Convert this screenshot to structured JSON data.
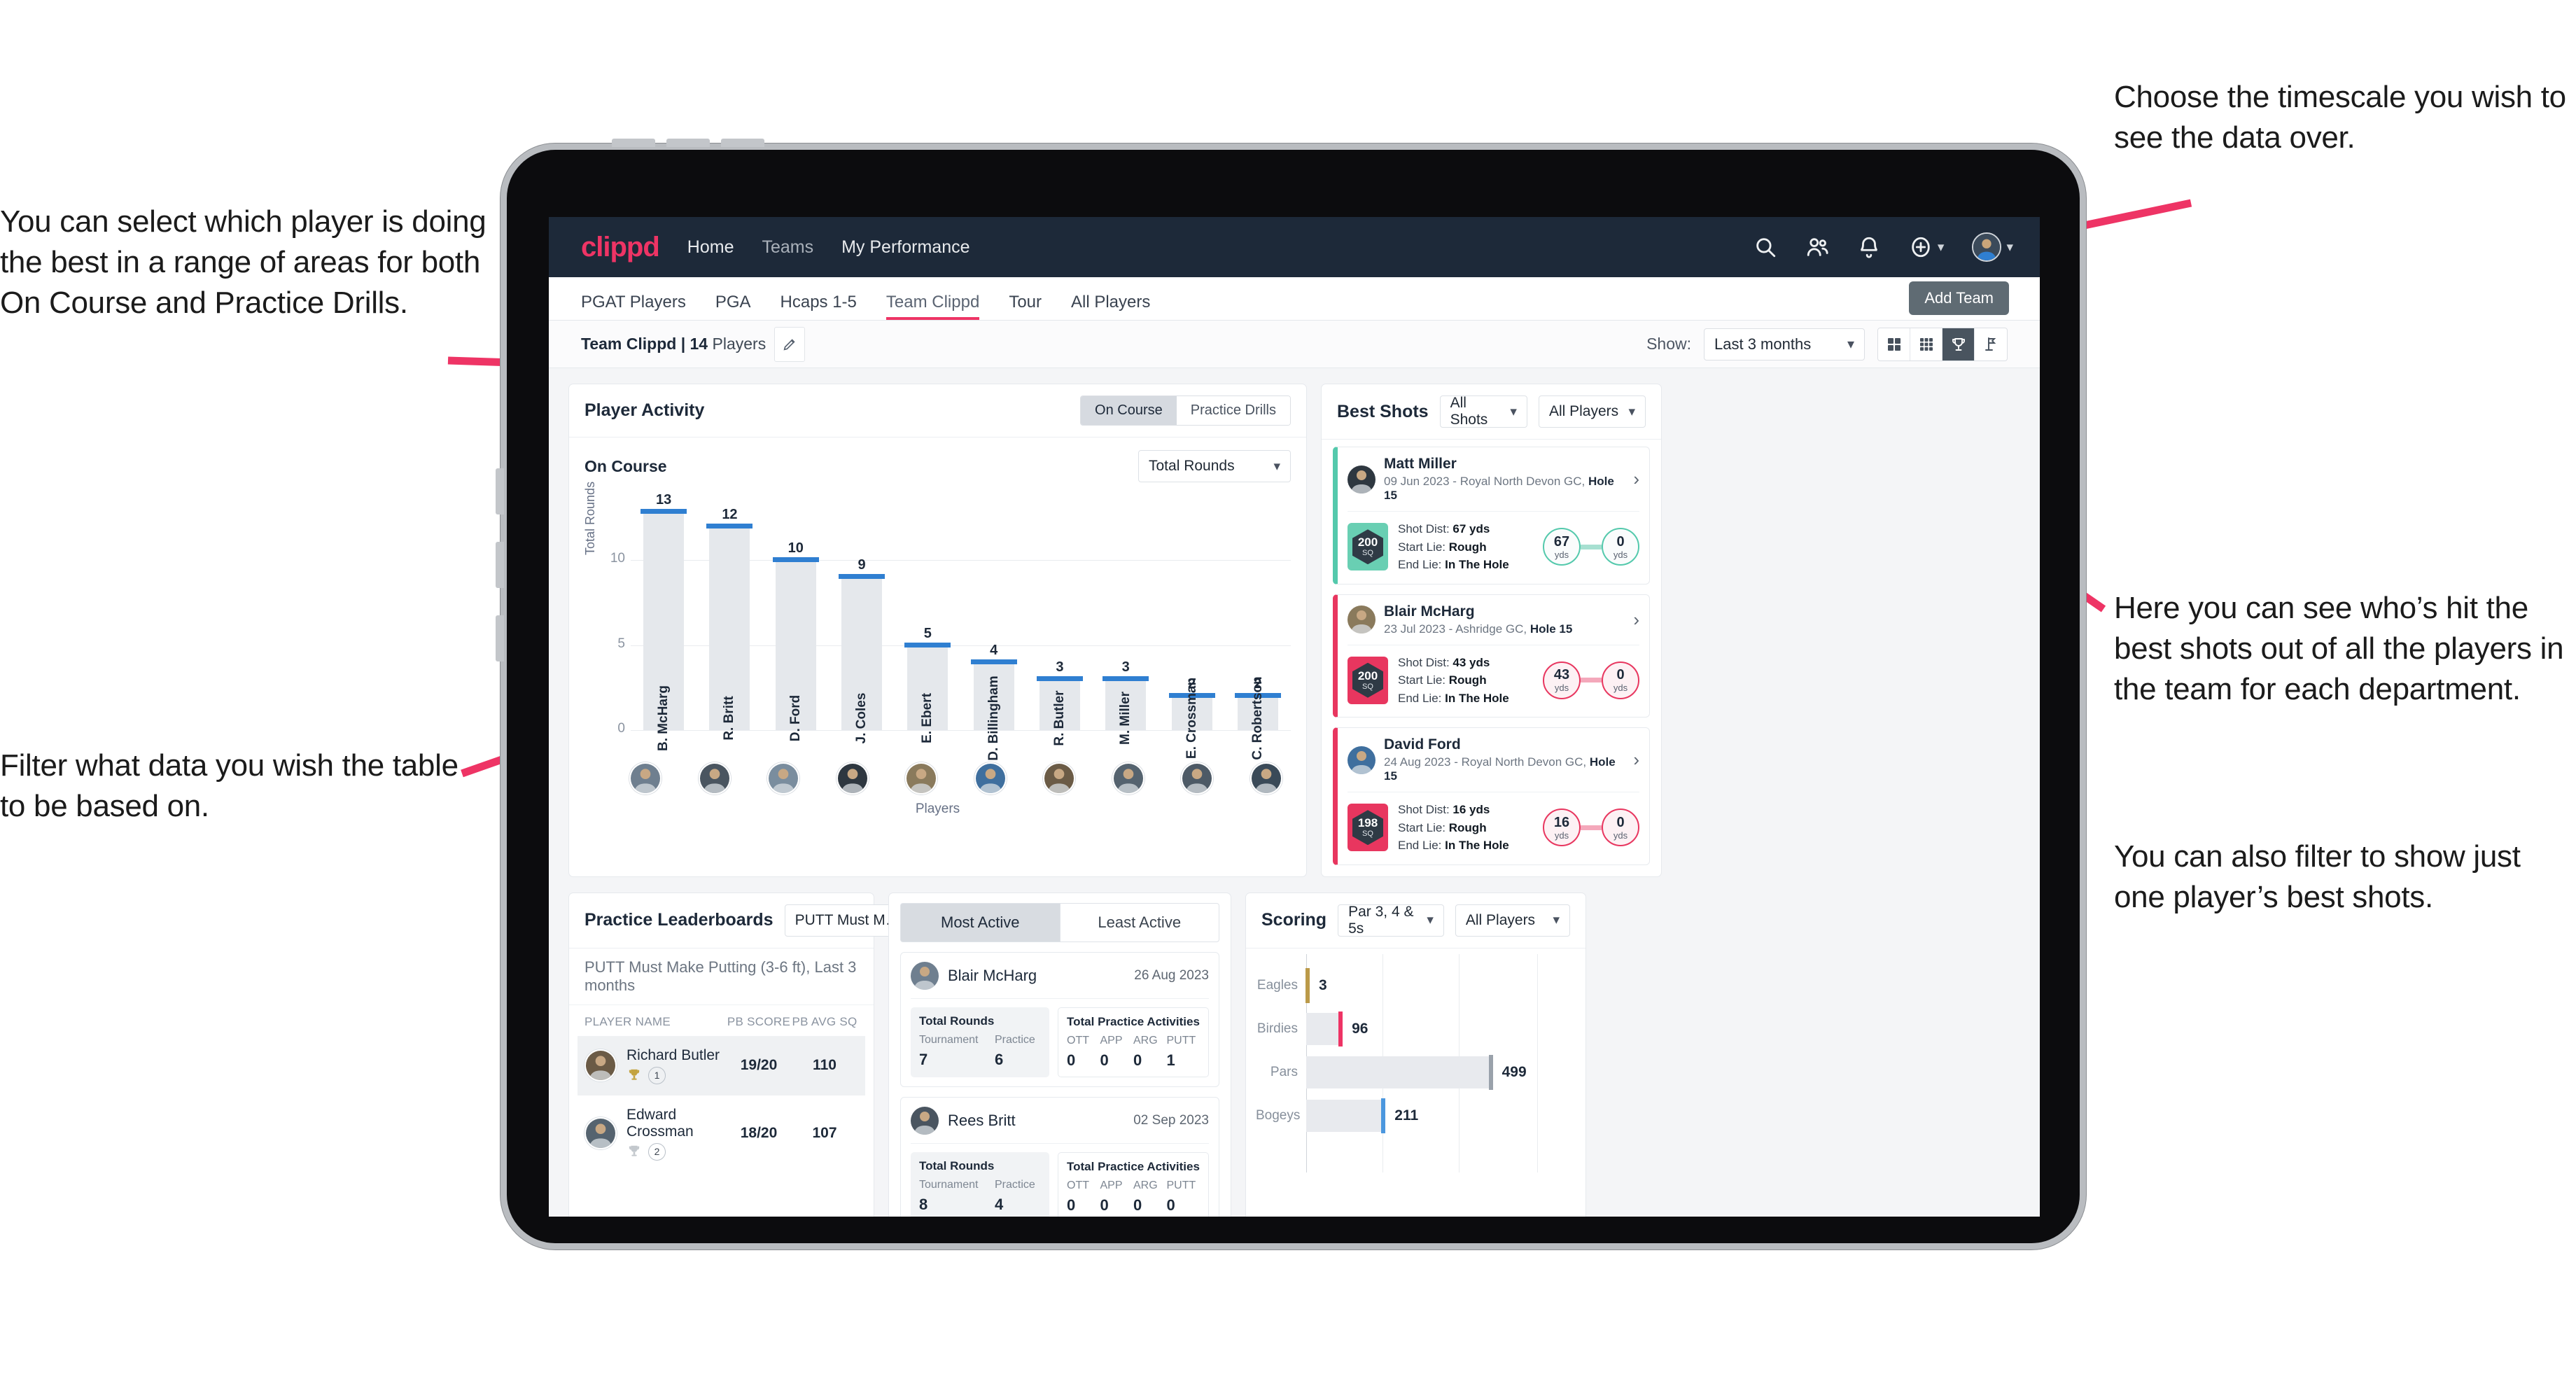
{
  "annotations": {
    "left_top": "You can select which player is doing the best in a range of areas for both On Course and Practice Drills.",
    "left_bottom": "Filter what data you wish the table to be based on.",
    "right_top": "Choose the timescale you wish to see the data over.",
    "right_mid": "Here you can see who’s hit the best shots out of all the players in the team for each department.",
    "right_bottom": "You can also filter to show just one player’s best shots."
  },
  "navbar": {
    "brand": "clippd",
    "links": [
      {
        "label": "Home",
        "dim": false
      },
      {
        "label": "Teams",
        "dim": true
      },
      {
        "label": "My Performance",
        "dim": false
      }
    ],
    "icons": [
      "search-icon",
      "people-icon",
      "bell-icon",
      "plus-circle-icon",
      "avatar"
    ]
  },
  "subtabs": {
    "items": [
      {
        "label": "PGAT Players",
        "active": false
      },
      {
        "label": "PGA",
        "active": false
      },
      {
        "label": "Hcaps 1-5",
        "active": false
      },
      {
        "label": "Team Clippd",
        "active": true
      },
      {
        "label": "Tour",
        "active": false
      },
      {
        "label": "All Players",
        "active": false
      }
    ],
    "tooltip": "Add Team"
  },
  "toolbar": {
    "team_label_bold": "Team Clippd | 14",
    "team_label_reg": " Players",
    "edit_icon": "pencil-icon",
    "show_label": "Show:",
    "period_value": "Last 3 months",
    "views": [
      {
        "name": "grid-2x2-icon",
        "active": false
      },
      {
        "name": "grid-3x3-icon",
        "active": false
      },
      {
        "name": "trophy-icon",
        "active": true
      },
      {
        "name": "flag-icon",
        "active": false
      }
    ]
  },
  "player_activity": {
    "title": "Player Activity",
    "segments": [
      {
        "label": "On Course",
        "active": true
      },
      {
        "label": "Practice Drills",
        "active": false
      }
    ],
    "sub_label": "On Course",
    "metric_value": "Total Rounds"
  },
  "chart_data": [
    {
      "type": "bar",
      "title": "Player Activity — On Course",
      "xlabel": "Players",
      "ylabel": "Total Rounds",
      "ylim": [
        0,
        14
      ],
      "yticks": [
        0,
        5,
        10
      ],
      "grid": true,
      "categories": [
        "B. McHarg",
        "R. Britt",
        "D. Ford",
        "J. Coles",
        "E. Ebert",
        "D. Billingham",
        "R. Butler",
        "M. Miller",
        "E. Crossman",
        "C. Robertson"
      ],
      "values": [
        13,
        12,
        10,
        9,
        5,
        4,
        3,
        3,
        2,
        2
      ],
      "bar_color": "#e5e8ec",
      "cap_color": "#2f7fd1"
    },
    {
      "type": "bar",
      "orientation": "horizontal",
      "title": "Scoring",
      "categories": [
        "Eagles",
        "Birdies",
        "Pars",
        "Bogeys"
      ],
      "values": [
        3,
        96,
        499,
        211
      ],
      "cap_colors": [
        "#bb9a49",
        "#ee3465",
        "#9aa2ab",
        "#4b97de"
      ],
      "xlim": [
        0,
        620
      ],
      "grid": true
    }
  ],
  "best_shots": {
    "title": "Best Shots",
    "filter_shots": "All Shots",
    "filter_players": "All Players",
    "items": [
      {
        "player": "Matt Miller",
        "meta_plain": "09 Jun 2023 - Royal North Devon GC, ",
        "meta_bold": "Hole 15",
        "score": "200",
        "score_unit": "SQ",
        "accent": "teal",
        "shot_dist_key": "Shot Dist:",
        "shot_dist": "67 yds",
        "start_lie_key": "Start Lie:",
        "start_lie": "Rough",
        "end_lie_key": "End Lie:",
        "end_lie": "In The Hole",
        "from_val": "67",
        "from_unit": "yds",
        "to_val": "0",
        "to_unit": "yds"
      },
      {
        "player": "Blair McHarg",
        "meta_plain": "23 Jul 2023 - Ashridge GC, ",
        "meta_bold": "Hole 15",
        "score": "200",
        "score_unit": "SQ",
        "accent": "pink",
        "shot_dist_key": "Shot Dist:",
        "shot_dist": "43 yds",
        "start_lie_key": "Start Lie:",
        "start_lie": "Rough",
        "end_lie_key": "End Lie:",
        "end_lie": "In The Hole",
        "from_val": "43",
        "from_unit": "yds",
        "to_val": "0",
        "to_unit": "yds"
      },
      {
        "player": "David Ford",
        "meta_plain": "24 Aug 2023 - Royal North Devon GC, ",
        "meta_bold": "Hole 15",
        "score": "198",
        "score_unit": "SQ",
        "accent": "pink",
        "shot_dist_key": "Shot Dist:",
        "shot_dist": "16 yds",
        "start_lie_key": "Start Lie:",
        "start_lie": "Rough",
        "end_lie_key": "End Lie:",
        "end_lie": "In The Hole",
        "from_val": "16",
        "from_unit": "yds",
        "to_val": "0",
        "to_unit": "yds"
      }
    ]
  },
  "practice_leaderboards": {
    "title": "Practice Leaderboards",
    "drill_select": "PUTT Must Make Putting …",
    "subtitle_bold": "PUTT Must Make Putting (3-6 ft),",
    "subtitle_reg": " Last 3 months",
    "columns": [
      "PLAYER NAME",
      "PB SCORE",
      "PB AVG SQ"
    ],
    "rows": [
      {
        "name": "Richard Butler",
        "rank": "1",
        "trophy": "gold",
        "pb_score": "19/20",
        "pb_avg_sq": "110",
        "highlight": true
      },
      {
        "name": "Edward Crossman",
        "rank": "2",
        "trophy": "silver",
        "pb_score": "18/20",
        "pb_avg_sq": "107",
        "highlight": false
      }
    ]
  },
  "activity": {
    "tabs": [
      {
        "label": "Most Active",
        "active": true
      },
      {
        "label": "Least Active",
        "active": false
      }
    ],
    "rounds_title": "Total Rounds",
    "practice_title": "Total Practice Activities",
    "rounds_keys": [
      "Tournament",
      "Practice"
    ],
    "practice_keys": [
      "OTT",
      "APP",
      "ARG",
      "PUTT"
    ],
    "cards": [
      {
        "name": "Blair McHarg",
        "date": "26 Aug 2023",
        "rounds": [
          "7",
          "6"
        ],
        "practice": [
          "0",
          "0",
          "0",
          "1"
        ]
      },
      {
        "name": "Rees Britt",
        "date": "02 Sep 2023",
        "rounds": [
          "8",
          "4"
        ],
        "practice": [
          "0",
          "0",
          "0",
          "0"
        ]
      }
    ]
  },
  "scoring": {
    "title": "Scoring",
    "filter_par": "Par 3, 4 & 5s",
    "filter_players": "All Players"
  }
}
